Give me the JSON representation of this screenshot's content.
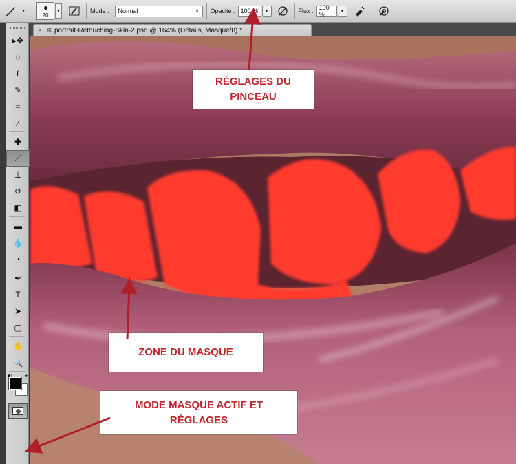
{
  "options_bar": {
    "tool_icon": "brush-icon",
    "brush_size": "20",
    "brush_panel_icon": "brush-panel-icon",
    "mode_label": "Mode :",
    "mode_value": "Normal",
    "opacity_label": "Opacité :",
    "opacity_value": "100 %",
    "opacity_pressure_icon": "pressure-opacity-icon",
    "flow_label": "Flux :",
    "flow_value": "100 %",
    "airbrush_icon": "airbrush-icon",
    "pressure_size_icon": "pressure-size-icon"
  },
  "document": {
    "tab_close": "×",
    "tab_title": "© portrait-Retouching-Skin-2.psd @ 164% (Détails, Masque/8) *"
  },
  "toolbox": {
    "tools": [
      {
        "name": "move-tool",
        "icon": "move-icon",
        "glyph": "▸✥"
      },
      {
        "name": "marquee-tool",
        "icon": "elliptical-marquee-icon",
        "glyph": "◌"
      },
      {
        "name": "lasso-tool",
        "icon": "lasso-icon",
        "glyph": "ℓ"
      },
      {
        "name": "quick-selection-tool",
        "icon": "quick-selection-icon",
        "glyph": "✎"
      },
      {
        "name": "crop-tool",
        "icon": "crop-icon",
        "glyph": "⌗"
      },
      {
        "name": "eyedropper-tool",
        "icon": "eyedropper-icon",
        "glyph": "⁄"
      },
      {
        "name": "healing-brush-tool",
        "icon": "bandage-icon",
        "glyph": "✚"
      },
      {
        "name": "brush-tool",
        "icon": "brush-icon",
        "glyph": "⟋",
        "active": true
      },
      {
        "name": "clone-stamp-tool",
        "icon": "stamp-icon",
        "glyph": "⊥"
      },
      {
        "name": "history-brush-tool",
        "icon": "history-brush-icon",
        "glyph": "↺"
      },
      {
        "name": "eraser-tool",
        "icon": "eraser-icon",
        "glyph": "◧"
      },
      {
        "name": "gradient-tool",
        "icon": "gradient-icon",
        "glyph": "▬"
      },
      {
        "name": "blur-tool",
        "icon": "blur-drop-icon",
        "glyph": "💧"
      },
      {
        "name": "dodge-tool",
        "icon": "dodge-icon",
        "glyph": "◔"
      },
      {
        "name": "pen-tool",
        "icon": "pen-icon",
        "glyph": "✒"
      },
      {
        "name": "type-tool",
        "icon": "type-icon",
        "glyph": "T"
      },
      {
        "name": "path-selection-tool",
        "icon": "path-selection-arrow-icon",
        "glyph": "➤"
      },
      {
        "name": "shape-tool",
        "icon": "rounded-rectangle-icon",
        "glyph": "▢"
      },
      {
        "name": "hand-tool",
        "icon": "hand-icon",
        "glyph": "✋"
      },
      {
        "name": "zoom-tool",
        "icon": "zoom-icon",
        "glyph": "🔍"
      }
    ],
    "fg_color": "#000000",
    "bg_color": "#ffffff",
    "quick_mask_mode": "active"
  },
  "annotations": [
    {
      "id": "brush-settings",
      "lines": [
        "RÉGLAGES DU",
        "PINCEAU"
      ]
    },
    {
      "id": "mask-zone",
      "lines": [
        "ZONE DU MASQUE"
      ]
    },
    {
      "id": "mask-mode",
      "lines": [
        "MODE MASQUE ACTIF ET",
        "RÉGLAGES"
      ]
    }
  ],
  "colors": {
    "annotation_text": "#c0262d",
    "arrow": "#b01e2a",
    "mask_overlay": "#ff3a2e"
  }
}
